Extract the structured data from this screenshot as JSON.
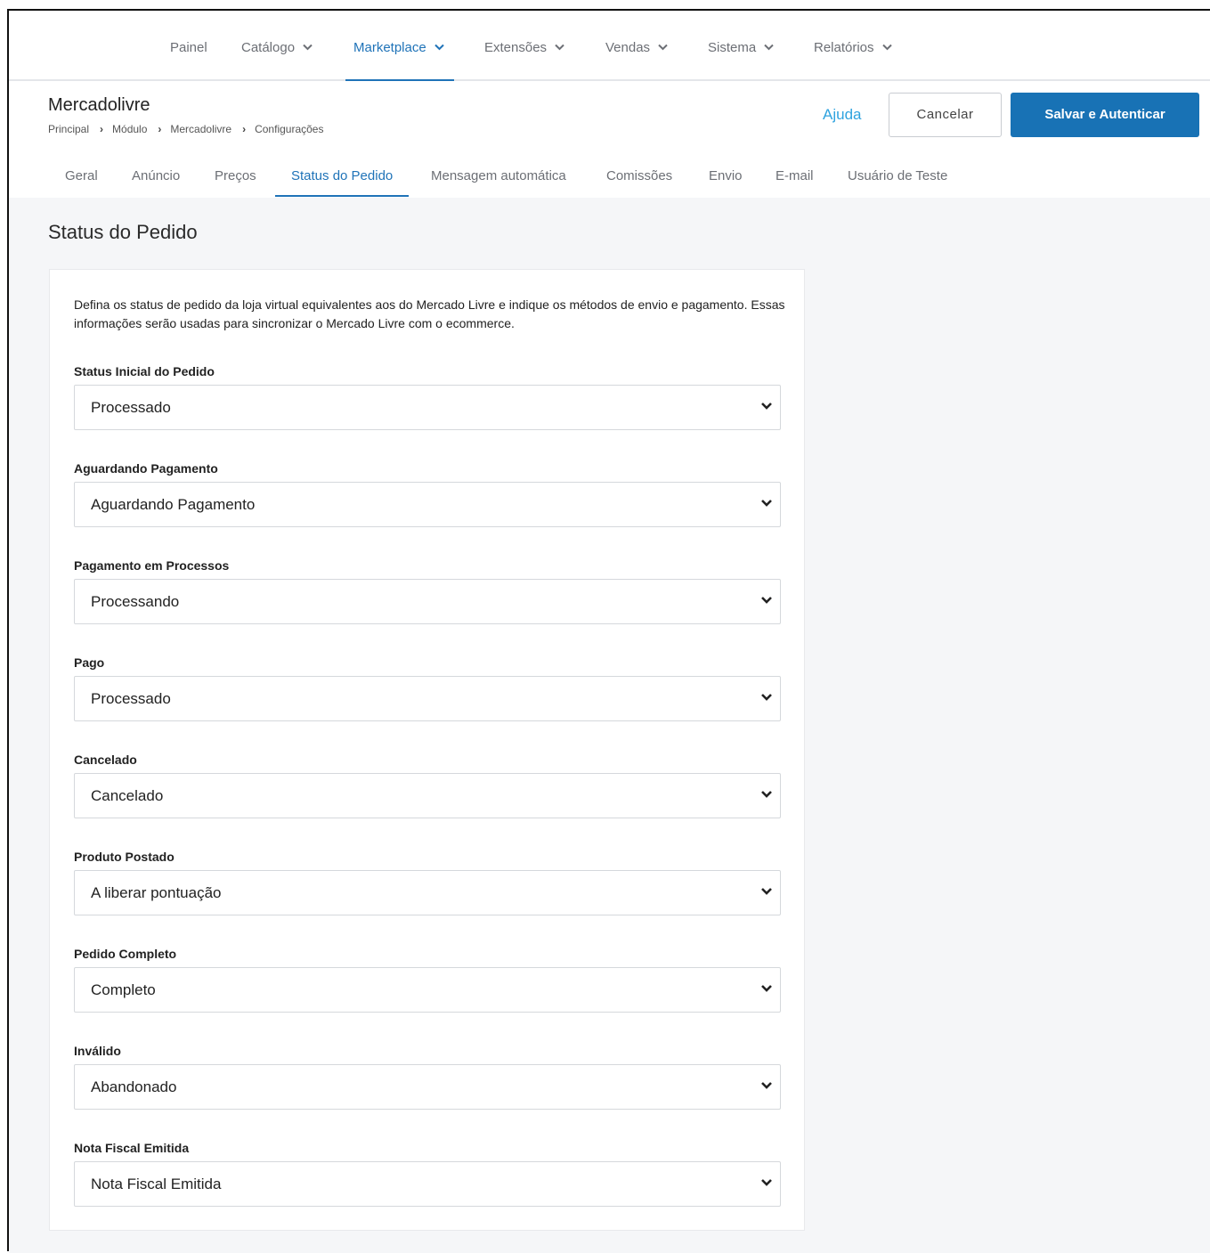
{
  "topnav": {
    "items": [
      {
        "label": "Painel",
        "has_chevron": false
      },
      {
        "label": "Catálogo",
        "has_chevron": true
      },
      {
        "label": "Marketplace",
        "has_chevron": true,
        "active": true
      },
      {
        "label": "Extensões",
        "has_chevron": true
      },
      {
        "label": "Vendas",
        "has_chevron": true
      },
      {
        "label": "Sistema",
        "has_chevron": true
      },
      {
        "label": "Relatórios",
        "has_chevron": true
      }
    ]
  },
  "header": {
    "title": "Mercadolivre",
    "breadcrumb": [
      "Principal",
      "Módulo",
      "Mercadolivre",
      "Configurações"
    ],
    "help_label": "Ajuda",
    "cancel_label": "Cancelar",
    "save_label": "Salvar e Autenticar"
  },
  "tabs": [
    {
      "label": "Geral"
    },
    {
      "label": "Anúncio"
    },
    {
      "label": "Preços"
    },
    {
      "label": "Status do Pedido",
      "active": true
    },
    {
      "label": "Mensagem automática"
    },
    {
      "label": "Comissões"
    },
    {
      "label": "Envio"
    },
    {
      "label": "E-mail"
    },
    {
      "label": "Usuário de Teste"
    }
  ],
  "section": {
    "title": "Status do Pedido",
    "description": "Defina os status de pedido da loja virtual equivalentes aos do Mercado Livre e indique os métodos de envio e pagamento. Essas informações serão usadas para sincronizar o Mercado Livre com o ecommerce."
  },
  "fields": [
    {
      "label": "Status Inicial do Pedido",
      "value": "Processado"
    },
    {
      "label": "Aguardando Pagamento",
      "value": "Aguardando Pagamento"
    },
    {
      "label": "Pagamento em Processos",
      "value": "Processando"
    },
    {
      "label": "Pago",
      "value": "Processado"
    },
    {
      "label": "Cancelado",
      "value": "Cancelado"
    },
    {
      "label": "Produto Postado",
      "value": "A liberar pontuação"
    },
    {
      "label": "Pedido Completo",
      "value": "Completo"
    },
    {
      "label": "Inválido",
      "value": "Abandonado"
    },
    {
      "label": "Nota Fiscal Emitida",
      "value": "Nota Fiscal Emitida"
    }
  ],
  "colors": {
    "accent": "#1f73b8",
    "primary_button": "#1872b5",
    "help_link": "#2fa3df",
    "content_background": "#f5f6f8"
  },
  "icons": {
    "nav_chevron": "chevron-down-icon",
    "breadcrumb_separator": "chevron-right-icon",
    "select_caret": "chevron-down-icon"
  }
}
